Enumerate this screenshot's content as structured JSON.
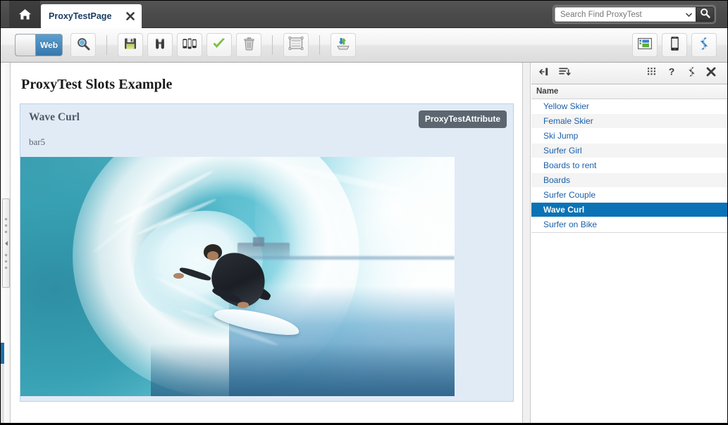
{
  "window": {
    "home_icon": "home-icon"
  },
  "tab": {
    "label": "ProxyTestPage",
    "close_icon": "close-icon"
  },
  "search": {
    "value": "Search Find ProxyTest",
    "placeholder": "Search Find ProxyTest",
    "dropdown_icon": "chevron-down-icon",
    "button_icon": "search-icon"
  },
  "toolbar": {
    "toggle": {
      "label": "Web",
      "state": "on"
    },
    "buttons": [
      {
        "name": "magnifier-button",
        "icon": "magnifier-icon",
        "title": "Preview"
      },
      {
        "name": "save-button",
        "icon": "floppy-disk-icon",
        "title": "Save"
      },
      {
        "name": "binoculars-button",
        "icon": "binoculars-icon",
        "title": "Find"
      },
      {
        "name": "devices-button",
        "icon": "devices-icon",
        "title": "Devices"
      },
      {
        "name": "validate-button",
        "icon": "green-check-icon",
        "title": "Validate"
      },
      {
        "name": "delete-button",
        "icon": "trash-can-icon",
        "title": "Delete"
      },
      {
        "name": "layout-button",
        "icon": "layout-rows-icon",
        "title": "Layout"
      },
      {
        "name": "publish-button",
        "icon": "import-export-icon",
        "title": "Publish"
      },
      {
        "name": "desktop-preview-button",
        "icon": "desktop-screen-icon",
        "title": "Desktop preview"
      },
      {
        "name": "mobile-preview-button",
        "icon": "smartphone-icon",
        "title": "Mobile preview"
      },
      {
        "name": "refresh-button",
        "icon": "sync-arrows-icon",
        "title": "Refresh"
      }
    ]
  },
  "content": {
    "page_title": "ProxyTest Slots Example",
    "slot": {
      "heading": "Wave Curl",
      "subtext": "bar5",
      "badge": "ProxyTestAttribute",
      "image_alt": "surfer-in-wave-barrel-photo"
    }
  },
  "right_panel": {
    "toolbar_icons": [
      {
        "name": "collapse-panel-icon",
        "glyph": "collapse"
      },
      {
        "name": "sort-descending-icon",
        "glyph": "sort"
      },
      {
        "name": "grid-dots-icon",
        "glyph": "dots"
      },
      {
        "name": "help-icon",
        "glyph": "?"
      },
      {
        "name": "sync-arrows-icon",
        "glyph": "sync"
      },
      {
        "name": "close-icon",
        "glyph": "x"
      }
    ],
    "column_header": "Name",
    "items": [
      {
        "label": "Yellow Skier",
        "selected": false
      },
      {
        "label": "Female Skier",
        "selected": false
      },
      {
        "label": "Ski Jump",
        "selected": false
      },
      {
        "label": "Surfer Girl",
        "selected": false
      },
      {
        "label": "Boards to rent",
        "selected": false
      },
      {
        "label": "Boards",
        "selected": false
      },
      {
        "label": "Surfer Couple",
        "selected": false
      },
      {
        "label": "Wave Curl",
        "selected": true
      },
      {
        "label": "Surfer on Bike",
        "selected": false
      }
    ]
  },
  "colors": {
    "titlebar": "#4b4b4b",
    "tab_text": "#1b3c63",
    "accent_blue": "#0b72b5",
    "link_blue": "#1a5fa8",
    "card_bg": "#e1ebf6",
    "card_border": "#b9d2e8",
    "badge_bg": "#5c6670",
    "toggle_on": "#3778ad"
  }
}
